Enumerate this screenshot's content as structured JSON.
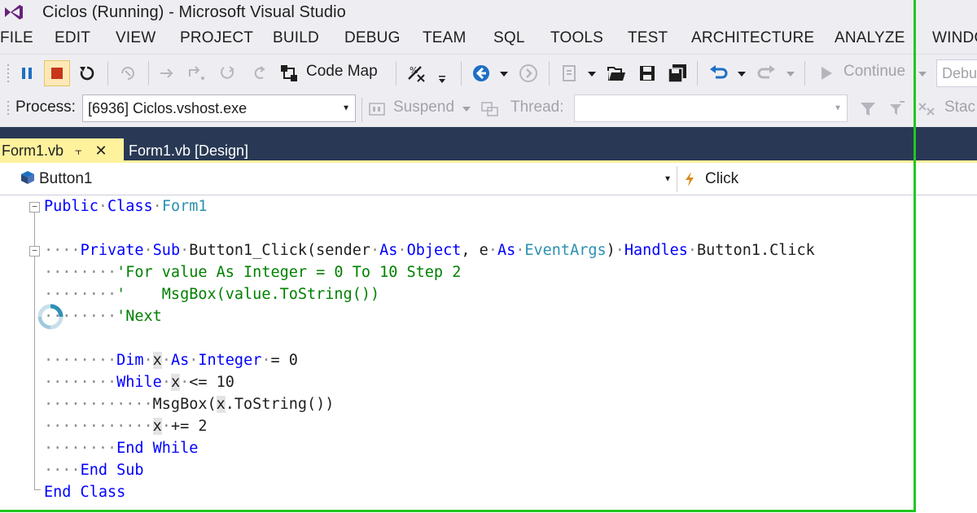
{
  "window": {
    "title": "Ciclos (Running) - Microsoft Visual Studio"
  },
  "menu": {
    "items": [
      "FILE",
      "EDIT",
      "VIEW",
      "PROJECT",
      "BUILD",
      "DEBUG",
      "TEAM",
      "SQL",
      "TOOLS",
      "TEST",
      "ARCHITECTURE",
      "ANALYZE",
      "WINDO"
    ]
  },
  "toolbar1": {
    "code_map_label": "Code Map",
    "continue_label": "Continue",
    "config_value": "Debu"
  },
  "toolbar2": {
    "process_label": "Process:",
    "process_value": "[6936] Ciclos.vshost.exe",
    "suspend_label": "Suspend",
    "thread_label": "Thread:",
    "thread_value": "",
    "stack_label": "Stac"
  },
  "tabs": {
    "active_label": "Form1.vb",
    "inactive_label": "Form1.vb [Design]"
  },
  "navbar": {
    "object_value": "Button1",
    "event_value": "Click"
  },
  "code": {
    "l1_kw1": "Public",
    "l1_kw2": "Class",
    "l1_type": "Form1",
    "l3_kw1": "Private",
    "l3_kw2": "Sub",
    "l3_name": "Button1_Click(sender",
    "l3_as1": "As",
    "l3_obj": "Object",
    "l3_comma": ", e",
    "l3_as2": "As",
    "l3_type2": "EventArgs",
    "l3_paren": ")",
    "l3_handles": "Handles",
    "l3_tail": "Button1.Click",
    "l4_comment": "'For value As Integer = 0 To 10 Step 2",
    "l5_comment": "'    MsgBox(value.ToString())",
    "l6_comment": "'Next",
    "l8_dim": "Dim",
    "l8_x": "x",
    "l8_as": "As",
    "l8_int": "Integer",
    "l8_rest": "= 0",
    "l9_while": "While",
    "l9_x": "x",
    "l9_rest": "<= 10",
    "l10_text": "MsgBox(",
    "l10_x": "x",
    "l10_rest": ".ToString())",
    "l11_x": "x",
    "l11_rest": "+= 2",
    "l12_kw": "End While",
    "l13_kw": "End Sub",
    "l14_kw": "End Class"
  },
  "colors": {
    "keyword": "#0000ff",
    "type": "#2b91af",
    "comment": "#008000",
    "tab_active": "#fff29d",
    "tab_strip": "#293955",
    "break_stop": "#e05a1e",
    "highlight_frame": "#22c722"
  }
}
